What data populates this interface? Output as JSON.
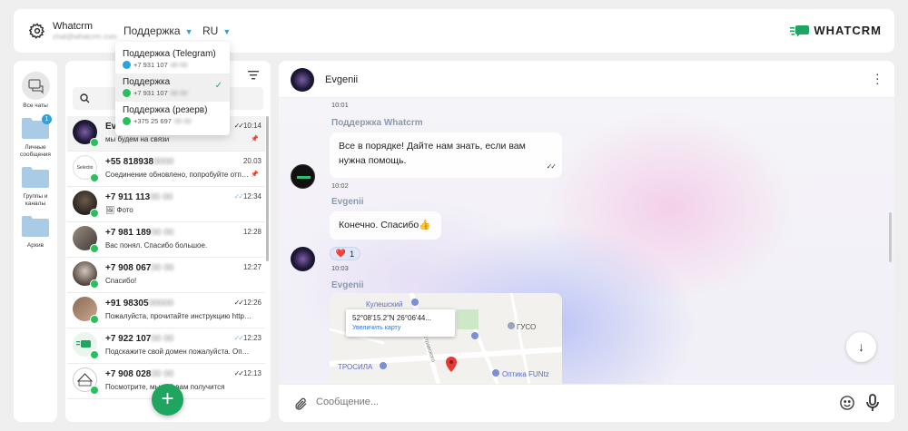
{
  "topbar": {
    "account_name": "Whatcrm",
    "account_email": "chat@whatcrm.com",
    "channel_selected": "Поддержка",
    "language": "RU",
    "logo_text": "WHATCRM"
  },
  "channel_dropdown": {
    "items": [
      {
        "name": "Поддержка (Telegram)",
        "phone": "+7 931 107",
        "phone_hidden": "00 00",
        "messenger": "telegram",
        "selected": false
      },
      {
        "name": "Поддержка",
        "phone": "+7 931 107",
        "phone_hidden": "00 00",
        "messenger": "whatsapp",
        "selected": true
      },
      {
        "name": "Поддержка (резерв)",
        "phone": "+375 25 697",
        "phone_hidden": "00 00",
        "messenger": "whatsapp",
        "selected": false
      }
    ]
  },
  "folders": {
    "all_chats": "Все чаты",
    "personal": "Личные сообщения",
    "personal_badge": "1",
    "groups": "Группы и каналы",
    "archive": "Архив"
  },
  "chat_list": {
    "items": [
      {
        "name": "Ev",
        "name_hidden": "",
        "preview": "мы будем на связи",
        "time": "10:14",
        "ticks": "read",
        "pinned": true,
        "active": true
      },
      {
        "name": "+55 818938",
        "name_hidden": "0000",
        "preview": "Соединение обновлено, попробуйте отправить сообщение",
        "time": "20.03",
        "ticks": "none",
        "pinned": true,
        "active": false
      },
      {
        "name": "+7 911 113",
        "name_hidden": "00 00",
        "preview": "🖼 Фото",
        "time": "12:34",
        "ticks": "delivered",
        "pinned": false,
        "active": false
      },
      {
        "name": "+7 981 189",
        "name_hidden": "00 00",
        "preview": "Вас понял. Спасибо большое.",
        "time": "12:28",
        "ticks": "none",
        "pinned": false,
        "active": false
      },
      {
        "name": "+7 908 067",
        "name_hidden": "00 00",
        "preview": "Спасибо!",
        "time": "12:27",
        "ticks": "none",
        "pinned": false,
        "active": false
      },
      {
        "name": "+91 98305",
        "name_hidden": "00000",
        "preview": "Пожалуйста, прочитайте инструкцию https://whatcrm.net",
        "time": "12:26",
        "ticks": "read",
        "pinned": false,
        "active": false
      },
      {
        "name": "+7 922 107",
        "name_hidden": "00 00",
        "preview": "Подскажите свой домен пожалуйста. Оплата прошла",
        "time": "12:23",
        "ticks": "delivered",
        "pinned": false,
        "active": false
      },
      {
        "name": "+7 908 028",
        "name_hidden": "00 00",
        "preview": "Посмотрите, мы всё вам получится",
        "time": "12:13",
        "ticks": "read",
        "pinned": false,
        "active": false
      }
    ]
  },
  "chat": {
    "contact_name": "Evgenii",
    "top_time": "10:01",
    "messages": {
      "m1_sender": "Поддержка Whatcrm",
      "m1_text": "Все в порядке! Дайте нам знать, если вам нужна помощь.",
      "m1_time": "10:02",
      "m2_sender": "Evgenii",
      "m2_text": "Конечно. Спасибо👍",
      "m2_reaction": "❤️",
      "m2_reaction_count": "1",
      "m2_time": "10:03",
      "m3_sender": "Evgenii",
      "m3_coords": "52°08'15.2\"N 26°06'44...",
      "m3_link": "Увеличить карту",
      "map_labels": [
        "Кулешский",
        "ГУСО",
        "ТРОСИЛА",
        "Оптика FUNtz",
        "Остравского"
      ]
    },
    "composer_placeholder": "Сообщение..."
  },
  "colors": {
    "accent_blue": "#2fa0d8",
    "whatsapp_green": "#28c05a",
    "fab_green": "#20a560"
  }
}
